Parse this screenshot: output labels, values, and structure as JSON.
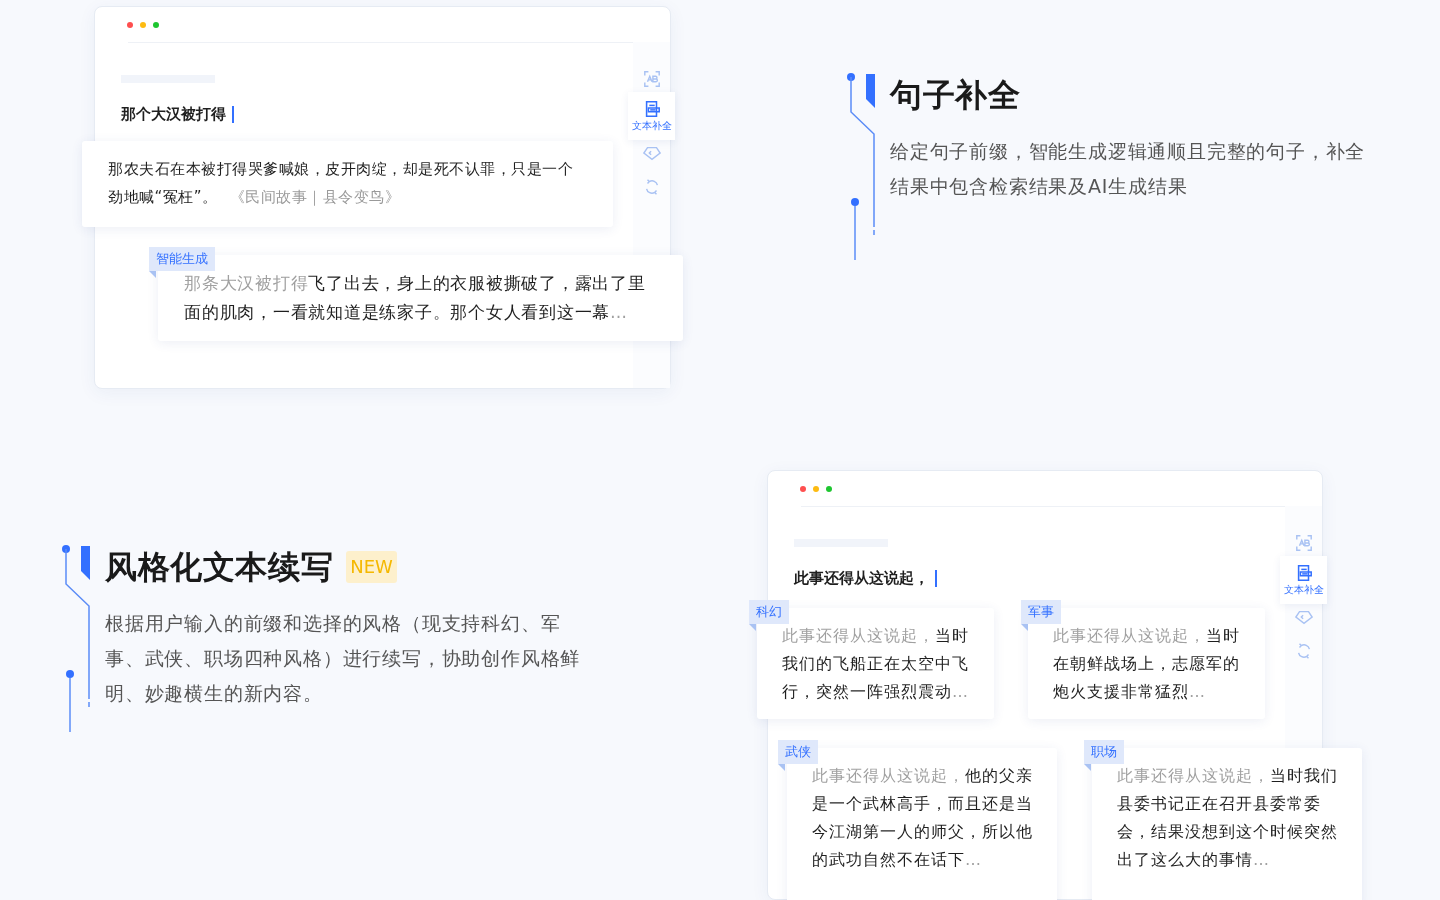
{
  "sections": [
    {
      "kind": "sentence_completion",
      "feature": {
        "title": "句子补全",
        "description": "给定句子前缀，智能生成逻辑通顺且完整的句子，补全结果中包含检索结果及AI生成结果"
      },
      "demo": {
        "input": "那个大汉被打得",
        "tools": [
          {
            "kind": "translate",
            "selected": false
          },
          {
            "kind": "document",
            "label": "文本补全",
            "selected": true
          },
          {
            "kind": "tag",
            "selected": false
          },
          {
            "kind": "refresh",
            "selected": false
          }
        ],
        "results": [
          {
            "kind": "retrieved",
            "text": "那农夫石在本被打得哭爹喊娘，皮开肉绽，却是死不认罪，只是一个劲地喊“冤枉”。",
            "source": "《民间故事｜县令变鸟》"
          },
          {
            "kind": "generated",
            "tag": "智能生成",
            "prefix": "那条大汉被打得",
            "text": "飞了出去，身上的衣服被撕破了，露出了里面的肌肉，一看就知道是练家子。那个女人看到这一幕",
            "ellipsis": "…"
          }
        ]
      }
    },
    {
      "kind": "style_continuation",
      "feature": {
        "title": "风格化文本续写",
        "badge": "NEW",
        "description": "根据用户输入的前缀和选择的风格（现支持科幻、军事、武侠、职场四种风格）进行续写，协助创作风格鲜明、妙趣横生的新内容。"
      },
      "demo": {
        "input": "此事还得从这说起，",
        "tools": [
          {
            "kind": "translate",
            "selected": false
          },
          {
            "kind": "document",
            "label": "文本补全",
            "selected": true
          },
          {
            "kind": "tag",
            "selected": false
          },
          {
            "kind": "refresh",
            "selected": false
          }
        ],
        "results": [
          {
            "kind": "generated",
            "tag": "科幻",
            "prefix": "此事还得从这说起，",
            "text": "当时我们的飞船正在太空中飞行，突然一阵强烈震动",
            "ellipsis": "…"
          },
          {
            "kind": "generated",
            "tag": "军事",
            "prefix": "此事还得从这说起，",
            "text": "当时在朝鲜战场上，志愿军的炮火支援非常猛烈",
            "ellipsis": "…"
          },
          {
            "kind": "generated",
            "tag": "武侠",
            "prefix": "此事还得从这说起，",
            "text": "他的父亲是一个武林高手，而且还是当今江湖第一人的师父，所以他的武功自然不在话下",
            "ellipsis": "…"
          },
          {
            "kind": "generated",
            "tag": "职场",
            "prefix": "此事还得从这说起，",
            "text": "当时我们县委书记正在召开县委常委会，结果没想到这个时候突然出了这么大的事情",
            "ellipsis": "…"
          }
        ]
      }
    }
  ]
}
